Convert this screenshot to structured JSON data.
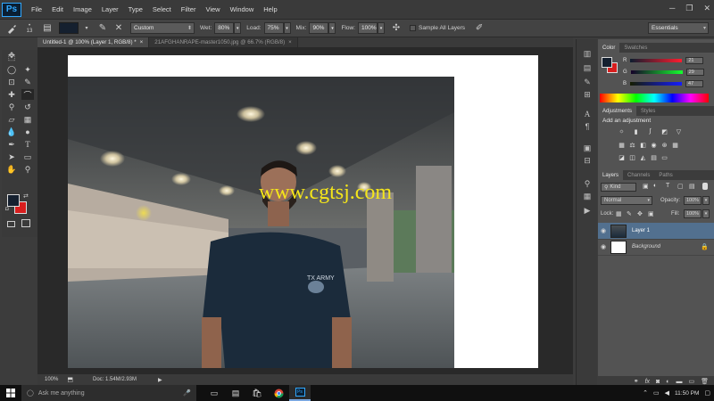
{
  "app": {
    "logo": "Ps"
  },
  "menu": [
    "File",
    "Edit",
    "Image",
    "Layer",
    "Type",
    "Select",
    "Filter",
    "View",
    "Window",
    "Help"
  ],
  "window_controls": {
    "minimize": "─",
    "restore": "❐",
    "close": "✕"
  },
  "options_bar": {
    "brush_size": "13",
    "preset": "Custom",
    "wet_label": "Wet:",
    "wet_value": "80%",
    "load_label": "Load:",
    "load_value": "75%",
    "mix_label": "Mix:",
    "mix_value": "90%",
    "flow_label": "Flow:",
    "flow_value": "100%",
    "sample_all_layers": "Sample All Layers",
    "workspace": "Essentials"
  },
  "tabs": [
    {
      "label": "Untitled-1 @ 100% (Layer 1, RGB/8) *",
      "close": "×"
    },
    {
      "label": "21AFGHANRAPE-master1050.jpg @ 66.7% (RGB/8)",
      "close": "×"
    }
  ],
  "canvas": {
    "watermark": "www.cgtsj.com",
    "shirt_print": "TX ARMY"
  },
  "status": {
    "zoom": "100%",
    "doc": "Doc: 1.54M/2.93M",
    "arrow": "▶"
  },
  "color_panel": {
    "tabs": [
      "Color",
      "Swatches"
    ],
    "r_label": "R",
    "r_value": "21",
    "g_label": "G",
    "g_value": "29",
    "b_label": "B",
    "b_value": "47"
  },
  "adjustments_panel": {
    "tabs": [
      "Adjustments",
      "Styles"
    ],
    "title": "Add an adjustment"
  },
  "layers_panel": {
    "tabs": [
      "Layers",
      "Channels",
      "Paths"
    ],
    "kind": "Kind",
    "blend_mode": "Normal",
    "opacity_label": "Opacity:",
    "opacity_value": "100%",
    "lock_label": "Lock:",
    "fill_label": "Fill:",
    "fill_value": "100%",
    "layers": [
      {
        "name": "Layer 1",
        "selected": true
      },
      {
        "name": "Background",
        "selected": false
      }
    ]
  },
  "taskbar": {
    "search_placeholder": "Ask me anything",
    "time": "11:50 PM"
  },
  "colors": {
    "foreground": "#15202f",
    "background": "#d81e1e",
    "watermark": "#f5e61a",
    "selection_highlight": "#52708f"
  }
}
